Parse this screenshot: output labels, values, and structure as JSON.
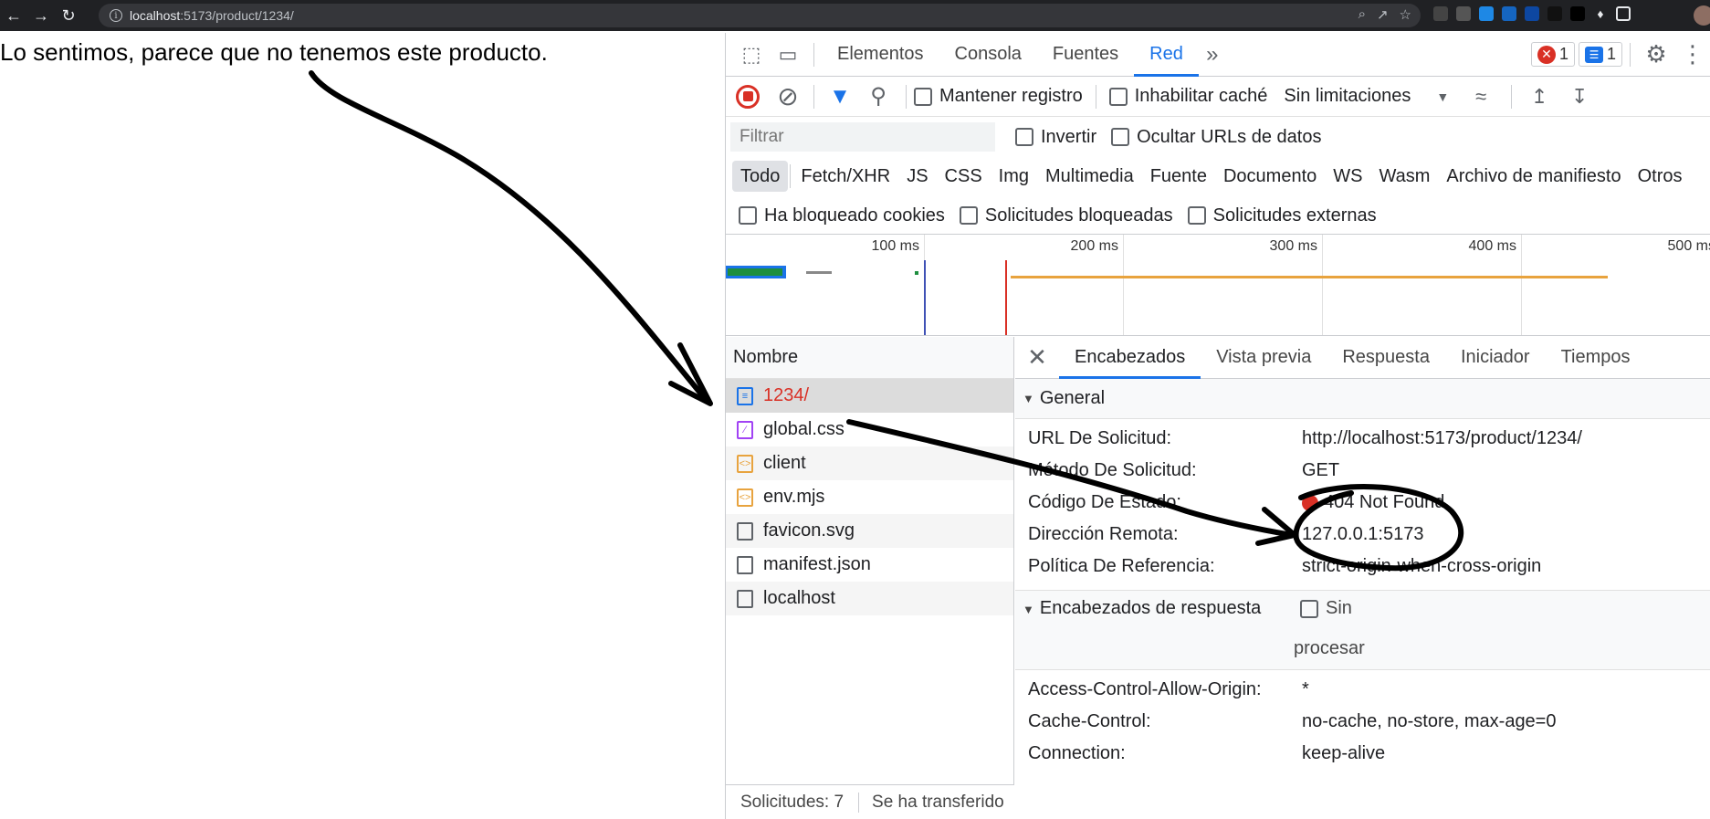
{
  "browser": {
    "url_host": "localhost",
    "url_path": ":5173/product/1234/"
  },
  "page": {
    "message": "Lo sentimos, parece que no tenemos este producto."
  },
  "devtools": {
    "tabs": [
      "Elementos",
      "Consola",
      "Fuentes",
      "Red"
    ],
    "active_tab": "Red",
    "error_count": "1",
    "message_count": "1",
    "toolbar": {
      "preserve_log": "Mantener registro",
      "disable_cache": "Inhabilitar caché",
      "throttling": "Sin limitaciones"
    },
    "filter": {
      "placeholder": "Filtrar",
      "invert": "Invertir",
      "hide_data_urls": "Ocultar URLs de datos"
    },
    "types": [
      "Todo",
      "Fetch/XHR",
      "JS",
      "CSS",
      "Img",
      "Multimedia",
      "Fuente",
      "Documento",
      "WS",
      "Wasm",
      "Archivo de manifiesto",
      "Otros"
    ],
    "blocked": {
      "blocked_cookies": "Ha bloqueado cookies",
      "blocked_requests": "Solicitudes bloqueadas",
      "third_party": "Solicitudes externas"
    },
    "timeline_ticks": [
      "100 ms",
      "200 ms",
      "300 ms",
      "400 ms",
      "500 ms"
    ],
    "name_header": "Nombre",
    "requests": [
      {
        "name": "1234/",
        "icon": "document-icon",
        "error": true
      },
      {
        "name": "global.css",
        "icon": "stylesheet-icon",
        "error": false
      },
      {
        "name": "client",
        "icon": "script-icon",
        "error": false
      },
      {
        "name": "env.mjs",
        "icon": "script-icon",
        "error": false
      },
      {
        "name": "favicon.svg",
        "icon": "file-icon",
        "error": false
      },
      {
        "name": "manifest.json",
        "icon": "file-icon",
        "error": false
      },
      {
        "name": "localhost",
        "icon": "file-icon",
        "error": false
      }
    ],
    "status_bar": {
      "requests": "Solicitudes: 7",
      "transferred": "Se ha transferido"
    },
    "detail_tabs": [
      "Encabezados",
      "Vista previa",
      "Respuesta",
      "Iniciador",
      "Tiempos"
    ],
    "general": {
      "title": "General",
      "rows": [
        {
          "key": "URL De Solicitud:",
          "value": "http://localhost:5173/product/1234/"
        },
        {
          "key": "Método De Solicitud:",
          "value": "GET"
        },
        {
          "key": "Código De Estado:",
          "value": "404 Not Found"
        },
        {
          "key": "Dirección Remota:",
          "value": "127.0.0.1:5173"
        },
        {
          "key": "Política De Referencia:",
          "value": "strict-origin-when-cross-origin"
        }
      ]
    },
    "response_headers": {
      "title": "Encabezados de respuesta",
      "raw_label_1": "Sin",
      "raw_label_2": "procesar",
      "rows": [
        {
          "key": "Access-Control-Allow-Origin:",
          "value": "*"
        },
        {
          "key": "Cache-Control:",
          "value": "no-cache, no-store, max-age=0"
        },
        {
          "key": "Connection:",
          "value": "keep-alive"
        }
      ]
    }
  },
  "colors": {
    "error": "#d93025",
    "accent": "#1a73e8",
    "annotation": "#000000"
  }
}
